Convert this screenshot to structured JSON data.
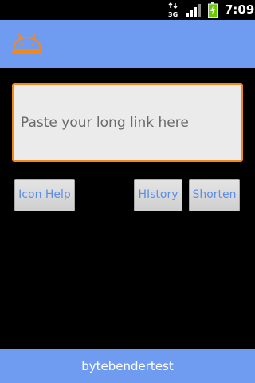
{
  "status_bar": {
    "network_type": "3G",
    "time": "7:09",
    "icons": [
      "network-activity-icon",
      "signal-strength-icon",
      "battery-charging-icon"
    ]
  },
  "action_bar": {
    "icon": "android-robot-icon",
    "background_color": "#6f9cf0"
  },
  "link_input": {
    "value": "",
    "placeholder": "Paste your long link here",
    "border_color": "#f2891f"
  },
  "buttons": {
    "icon_help": "Icon Help",
    "history": "HIstory",
    "shorten": "Shorten"
  },
  "footer": {
    "text": "bytebendertest"
  }
}
